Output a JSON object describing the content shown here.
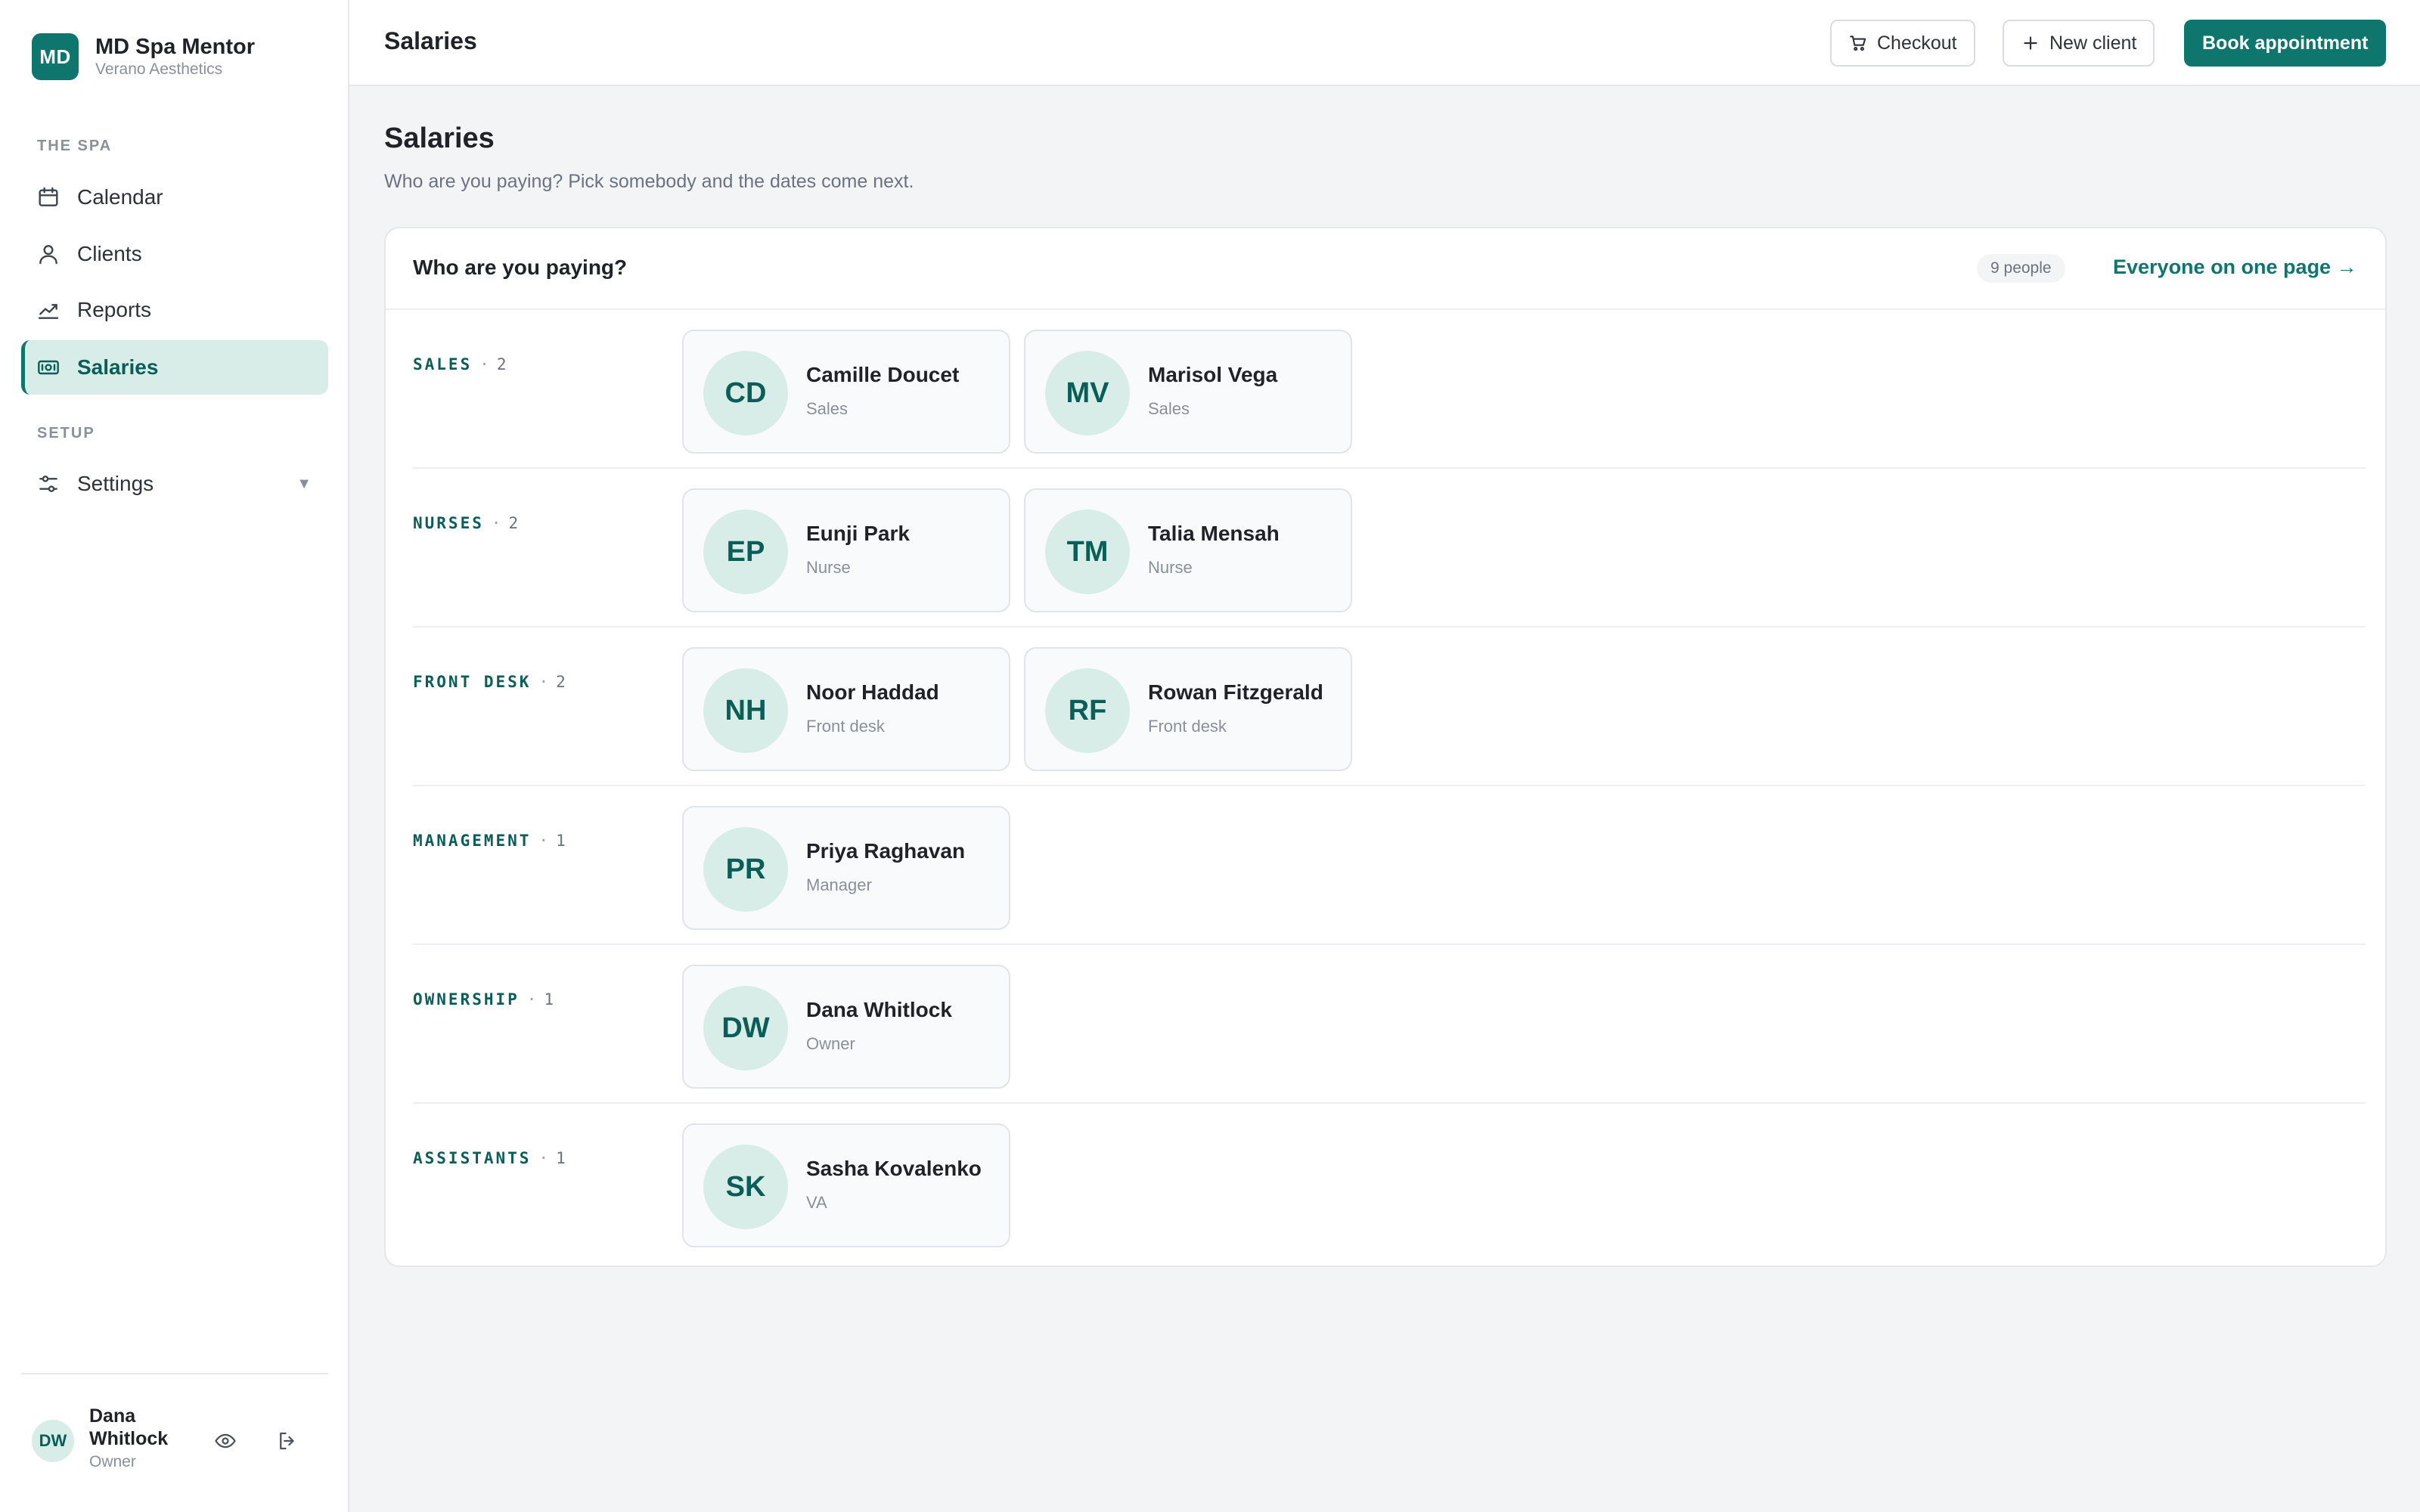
{
  "brand": {
    "initials": "MD",
    "name": "MD Spa Mentor",
    "subtitle": "Verano Aesthetics"
  },
  "sidebar": {
    "sections": [
      {
        "label": "THE SPA"
      },
      {
        "label": "SETUP"
      }
    ],
    "items": [
      {
        "label": "Calendar",
        "icon": "calendar-icon"
      },
      {
        "label": "Clients",
        "icon": "user-icon"
      },
      {
        "label": "Reports",
        "icon": "trend-chart-icon"
      },
      {
        "label": "Salaries",
        "icon": "cash-icon",
        "active": true
      },
      {
        "label": "Settings",
        "icon": "sliders-icon",
        "caret": "▼"
      }
    ]
  },
  "user": {
    "initials": "DW",
    "name": "Dana Whitlock",
    "role": "Owner"
  },
  "topbar": {
    "title": "Salaries",
    "checkout_label": "Checkout",
    "new_client_label": "New client",
    "book_label": "Book appointment"
  },
  "page": {
    "title": "Salaries",
    "subtitle": "Who are you paying? Pick somebody and the dates come next."
  },
  "card": {
    "title": "Who are you paying?",
    "count": "9 people",
    "all_link": "Everyone on one page →"
  },
  "groups": [
    {
      "label": "SALES",
      "count": "2",
      "people": [
        {
          "initials": "CD",
          "name": "Camille Doucet",
          "role": "Sales"
        },
        {
          "initials": "MV",
          "name": "Marisol Vega",
          "role": "Sales"
        }
      ]
    },
    {
      "label": "NURSES",
      "count": "2",
      "people": [
        {
          "initials": "EP",
          "name": "Eunji Park",
          "role": "Nurse"
        },
        {
          "initials": "TM",
          "name": "Talia Mensah",
          "role": "Nurse"
        }
      ]
    },
    {
      "label": "FRONT DESK",
      "count": "2",
      "people": [
        {
          "initials": "NH",
          "name": "Noor Haddad",
          "role": "Front desk"
        },
        {
          "initials": "RF",
          "name": "Rowan Fitzgerald",
          "role": "Front desk"
        }
      ]
    },
    {
      "label": "MANAGEMENT",
      "count": "1",
      "people": [
        {
          "initials": "PR",
          "name": "Priya Raghavan",
          "role": "Manager"
        }
      ]
    },
    {
      "label": "OWNERSHIP",
      "count": "1",
      "people": [
        {
          "initials": "DW",
          "name": "Dana Whitlock",
          "role": "Owner"
        }
      ]
    },
    {
      "label": "ASSISTANTS",
      "count": "1",
      "people": [
        {
          "initials": "SK",
          "name": "Sasha Kovalenko",
          "role": "VA"
        }
      ]
    }
  ],
  "colors": {
    "accent": "#0f766e",
    "accent_soft": "#d8ede8",
    "text": "#1f2328",
    "muted": "#8a9099"
  }
}
